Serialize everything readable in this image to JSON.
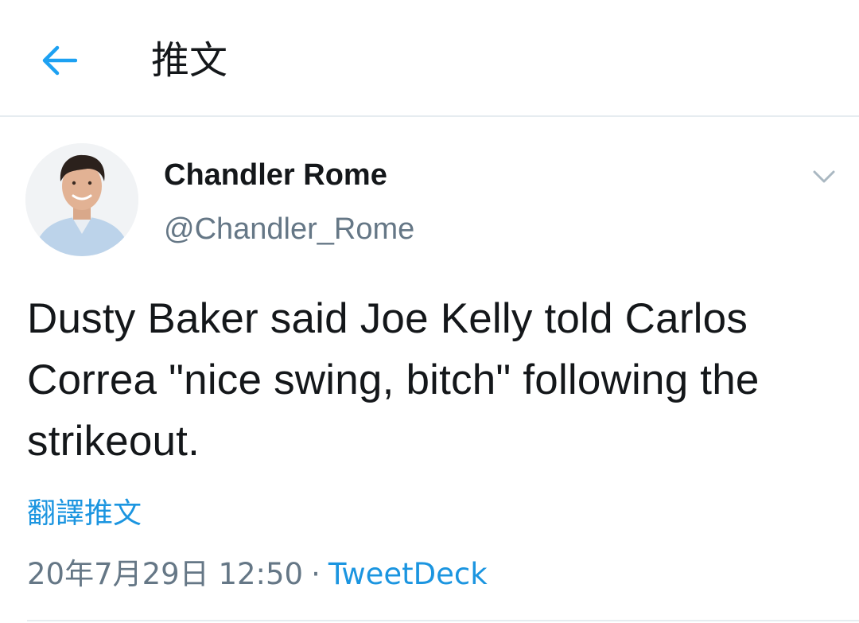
{
  "header": {
    "back_icon": "arrow-left-icon",
    "title": "推文",
    "accent_color": "#1da1f2"
  },
  "tweet": {
    "author": {
      "display_name": "Chandler Rome",
      "handle": "@Chandler_Rome",
      "avatar_icon": "profile-photo"
    },
    "menu_icon": "chevron-down-icon",
    "text": "Dusty Baker said Joe Kelly told Carlos Correa \"nice swing, bitch\" following the strikeout.",
    "translate_label": "翻譯推文",
    "timestamp": "20年7月29日 12:50",
    "separator": "·",
    "source": "TweetDeck",
    "link_color": "#1b95e0"
  }
}
